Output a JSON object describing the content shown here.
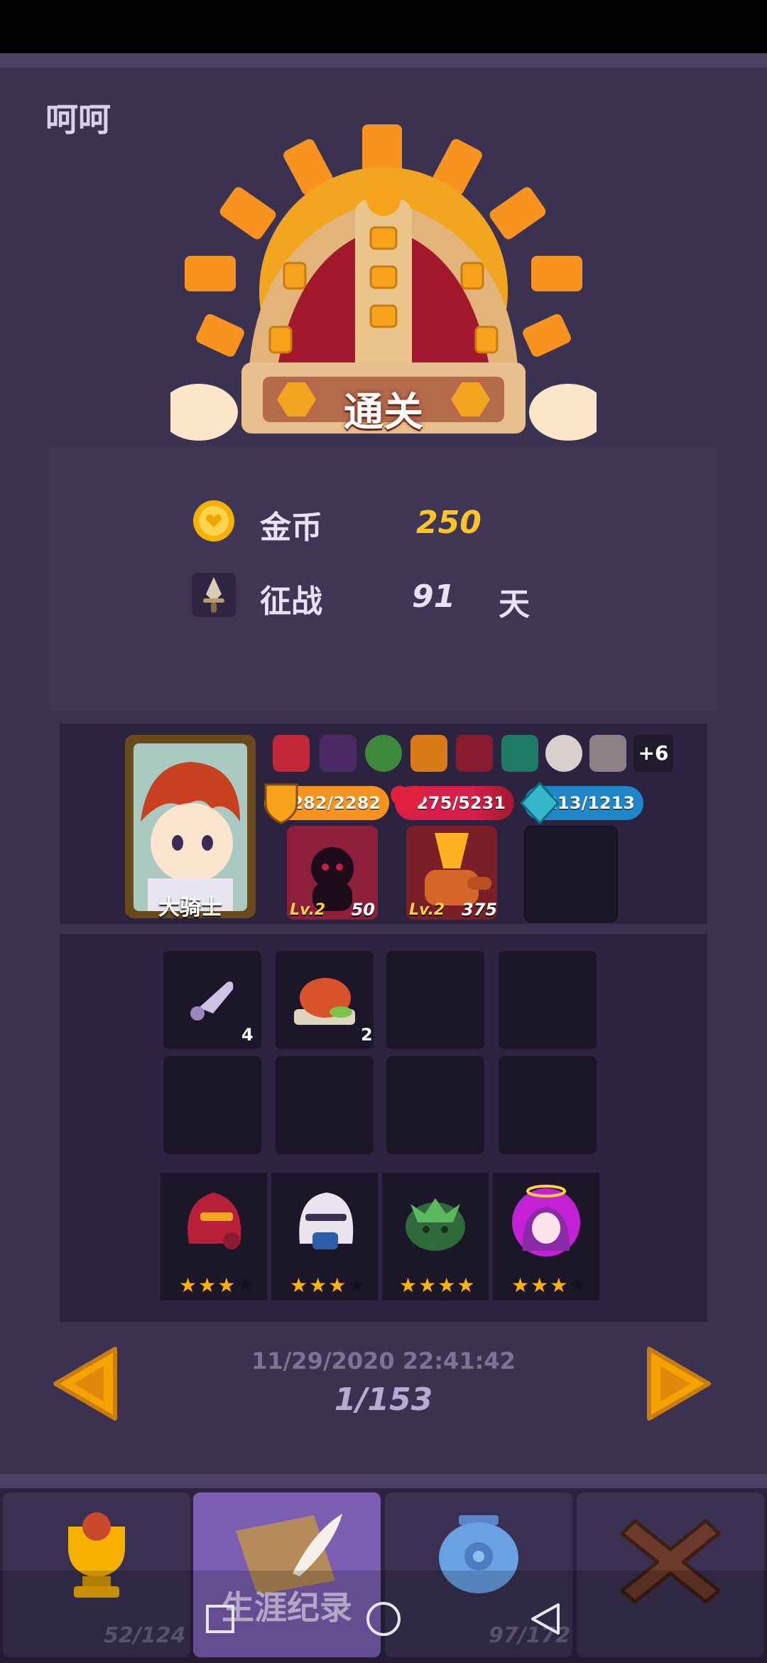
{
  "player": {
    "name": "呵呵"
  },
  "result": {
    "label": "通关"
  },
  "stats": [
    {
      "icon": "gold-coin-icon",
      "label": "金币",
      "value": "250",
      "unit": ""
    },
    {
      "icon": "sword-icon",
      "label": "征战",
      "value": "91",
      "unit": "天"
    }
  ],
  "hero": {
    "name": "大骑士",
    "more_items": "+6",
    "armor": "2282/2282",
    "hp": "1275/5231",
    "mana": "1213/1213",
    "armor_fraction": 1.0,
    "hp_fraction": 0.244,
    "mana_fraction": 1.0,
    "skills": [
      {
        "level": "Lv.2",
        "value": "50"
      },
      {
        "level": "Lv.2",
        "value": "375"
      }
    ]
  },
  "inventory": [
    {
      "name": "knife",
      "count": "4"
    },
    {
      "name": "roast-meat",
      "count": "2"
    }
  ],
  "units": [
    {
      "name": "red-knight",
      "stars": 3
    },
    {
      "name": "white-knight",
      "stars": 3
    },
    {
      "name": "green-plant",
      "stars": 4
    },
    {
      "name": "purple-angel",
      "stars": 3
    }
  ],
  "record": {
    "timestamp": "11/29/2020 22:41:42",
    "page": "1/153"
  },
  "tabs": [
    {
      "name": "trophy",
      "count": "52/124",
      "label": ""
    },
    {
      "name": "career",
      "count": "",
      "label": "生涯纪录"
    },
    {
      "name": "jar",
      "count": "97/172",
      "label": ""
    },
    {
      "name": "close",
      "count": "",
      "label": ""
    }
  ],
  "colors": {
    "gold": "#ffc425",
    "armor": "#f7931e",
    "hp": "#d81f4a",
    "mana": "#1f86c8"
  }
}
